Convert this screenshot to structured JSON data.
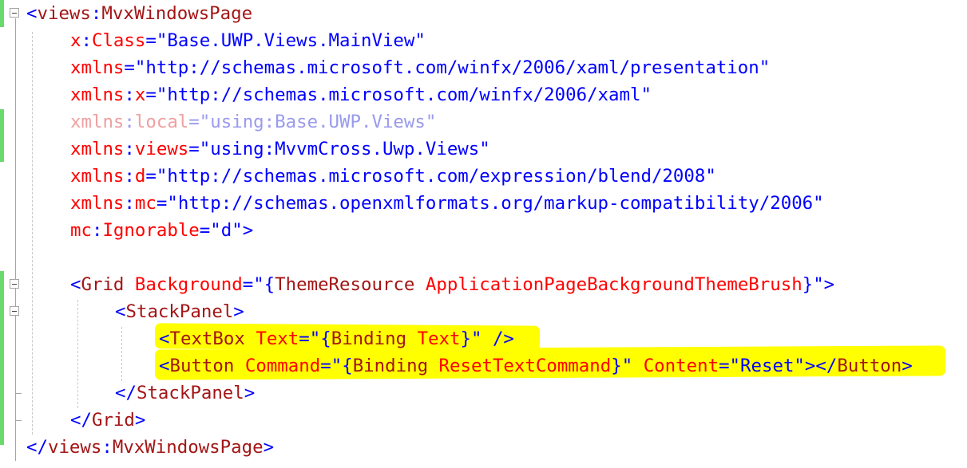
{
  "editor": {
    "lines": [
      [
        {
          "t": "<",
          "c": "pu"
        },
        {
          "t": "views",
          "c": "tk"
        },
        {
          "t": ":",
          "c": "pu"
        },
        {
          "t": "MvxWindowsPage",
          "c": "tk"
        }
      ],
      [
        {
          "t": "x",
          "c": "at"
        },
        {
          "t": ":",
          "c": "pu"
        },
        {
          "t": "Class",
          "c": "at"
        },
        {
          "t": "=",
          "c": "pu"
        },
        {
          "t": "\"Base.UWP.Views.MainView\"",
          "c": "va"
        }
      ],
      [
        {
          "t": "xmlns",
          "c": "at"
        },
        {
          "t": "=",
          "c": "pu"
        },
        {
          "t": "\"http://schemas.microsoft.com/winfx/2006/xaml/presentation\"",
          "c": "va"
        }
      ],
      [
        {
          "t": "xmlns",
          "c": "at"
        },
        {
          "t": ":",
          "c": "pu"
        },
        {
          "t": "x",
          "c": "at"
        },
        {
          "t": "=",
          "c": "pu"
        },
        {
          "t": "\"http://schemas.microsoft.com/winfx/2006/xaml\"",
          "c": "va"
        }
      ],
      [
        {
          "t": "xmlns",
          "c": "at"
        },
        {
          "t": ":",
          "c": "pu"
        },
        {
          "t": "local",
          "c": "at"
        },
        {
          "t": "=",
          "c": "pu"
        },
        {
          "t": "\"using:Base.UWP.Views\"",
          "c": "va"
        }
      ],
      [
        {
          "t": "xmlns",
          "c": "at"
        },
        {
          "t": ":",
          "c": "pu"
        },
        {
          "t": "views",
          "c": "at"
        },
        {
          "t": "=",
          "c": "pu"
        },
        {
          "t": "\"using:MvvmCross.Uwp.Views\"",
          "c": "va"
        }
      ],
      [
        {
          "t": "xmlns",
          "c": "at"
        },
        {
          "t": ":",
          "c": "pu"
        },
        {
          "t": "d",
          "c": "at"
        },
        {
          "t": "=",
          "c": "pu"
        },
        {
          "t": "\"http://schemas.microsoft.com/expression/blend/2008\"",
          "c": "va"
        }
      ],
      [
        {
          "t": "xmlns",
          "c": "at"
        },
        {
          "t": ":",
          "c": "pu"
        },
        {
          "t": "mc",
          "c": "at"
        },
        {
          "t": "=",
          "c": "pu"
        },
        {
          "t": "\"http://schemas.openxmlformats.org/markup-compatibility/2006\"",
          "c": "va"
        }
      ],
      [
        {
          "t": "mc",
          "c": "at"
        },
        {
          "t": ":",
          "c": "pu"
        },
        {
          "t": "Ignorable",
          "c": "at"
        },
        {
          "t": "=",
          "c": "pu"
        },
        {
          "t": "\"d\"",
          "c": "va"
        },
        {
          "t": ">",
          "c": "pu"
        }
      ],
      [],
      [
        {
          "t": "<",
          "c": "pu"
        },
        {
          "t": "Grid",
          "c": "tk"
        },
        {
          "t": " ",
          "c": "pu"
        },
        {
          "t": "Background",
          "c": "at"
        },
        {
          "t": "=",
          "c": "pu"
        },
        {
          "t": "\"",
          "c": "va"
        },
        {
          "t": "{",
          "c": "pu"
        },
        {
          "t": "ThemeResource",
          "c": "mk"
        },
        {
          "t": " ",
          "c": "pu"
        },
        {
          "t": "ApplicationPageBackgroundThemeBrush",
          "c": "ex"
        },
        {
          "t": "}",
          "c": "pu"
        },
        {
          "t": "\"",
          "c": "va"
        },
        {
          "t": ">",
          "c": "pu"
        }
      ],
      [
        {
          "t": "<",
          "c": "pu"
        },
        {
          "t": "StackPanel",
          "c": "tk"
        },
        {
          "t": ">",
          "c": "pu"
        }
      ],
      [
        {
          "t": "<",
          "c": "pu"
        },
        {
          "t": "TextBox",
          "c": "tk"
        },
        {
          "t": " ",
          "c": "pu"
        },
        {
          "t": "Text",
          "c": "at"
        },
        {
          "t": "=",
          "c": "pu"
        },
        {
          "t": "\"",
          "c": "va"
        },
        {
          "t": "{",
          "c": "pu"
        },
        {
          "t": "Binding",
          "c": "mk"
        },
        {
          "t": " ",
          "c": "pu"
        },
        {
          "t": "Text",
          "c": "ex"
        },
        {
          "t": "}",
          "c": "pu"
        },
        {
          "t": "\"",
          "c": "va"
        },
        {
          "t": " />",
          "c": "pu"
        }
      ],
      [
        {
          "t": "<",
          "c": "pu"
        },
        {
          "t": "Button",
          "c": "tk"
        },
        {
          "t": " ",
          "c": "pu"
        },
        {
          "t": "Command",
          "c": "at"
        },
        {
          "t": "=",
          "c": "pu"
        },
        {
          "t": "\"",
          "c": "va"
        },
        {
          "t": "{",
          "c": "pu"
        },
        {
          "t": "Binding",
          "c": "mk"
        },
        {
          "t": " ",
          "c": "pu"
        },
        {
          "t": "ResetTextCommand",
          "c": "ex"
        },
        {
          "t": "}",
          "c": "pu"
        },
        {
          "t": "\"",
          "c": "va"
        },
        {
          "t": " ",
          "c": "pu"
        },
        {
          "t": "Content",
          "c": "at"
        },
        {
          "t": "=",
          "c": "pu"
        },
        {
          "t": "\"Reset\"",
          "c": "va"
        },
        {
          "t": "></",
          "c": "pu"
        },
        {
          "t": "Button",
          "c": "tk"
        },
        {
          "t": ">",
          "c": "pu"
        }
      ],
      [
        {
          "t": "</",
          "c": "pu"
        },
        {
          "t": "StackPanel",
          "c": "tk"
        },
        {
          "t": ">",
          "c": "pu"
        }
      ],
      [
        {
          "t": "</",
          "c": "pu"
        },
        {
          "t": "Grid",
          "c": "tk"
        },
        {
          "t": ">",
          "c": "pu"
        }
      ],
      [
        {
          "t": "</",
          "c": "pu"
        },
        {
          "t": "views",
          "c": "tk"
        },
        {
          "t": ":",
          "c": "pu"
        },
        {
          "t": "MvxWindowsPage",
          "c": "tk"
        },
        {
          "t": ">",
          "c": "pu"
        }
      ]
    ],
    "highlighted_lines": [
      12,
      13
    ],
    "collapsed_markers": [
      "minus-icon",
      "minus-icon",
      "minus-icon"
    ],
    "colors": {
      "tag": "#a31515",
      "attribute": "#ff0000",
      "punctuation": "#0000ff",
      "value": "#0000ff",
      "highlight": "#ffff00",
      "change_bar": "#6cd96c"
    }
  }
}
